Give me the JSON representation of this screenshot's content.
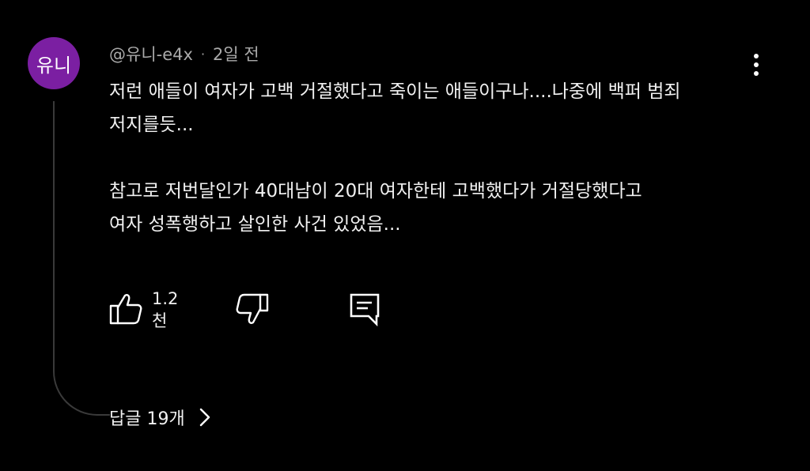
{
  "comment": {
    "avatar_text": "유니",
    "avatar_color": "#7b1fa2",
    "author": "@유니-e4x",
    "separator": "·",
    "time": "2일 전",
    "lines": [
      "저런 애들이 여자가 고백 거절했다고 죽이는 애들이구나....나중에 백퍼 범죄",
      "저지를듯...",
      "",
      "참고로 저번달인가 40대남이 20대 여자한테 고백했다가 거절당했다고",
      "여자 성폭행하고 살인한 사건 있었음..."
    ],
    "more_icon": "three-dots-vertical-icon"
  },
  "actions": {
    "like_icon": "thumbs-up-icon",
    "like_count": "1.2천",
    "dislike_icon": "thumbs-down-icon",
    "reply_icon": "comment-reply-icon"
  },
  "replies": {
    "label": "답글 19개",
    "chevron_icon": "chevron-right-icon"
  },
  "colors": {
    "background": "#000000",
    "text": "#f1f1f1",
    "meta_text": "#aaaaaa",
    "thread_line": "#3a3a3a"
  }
}
